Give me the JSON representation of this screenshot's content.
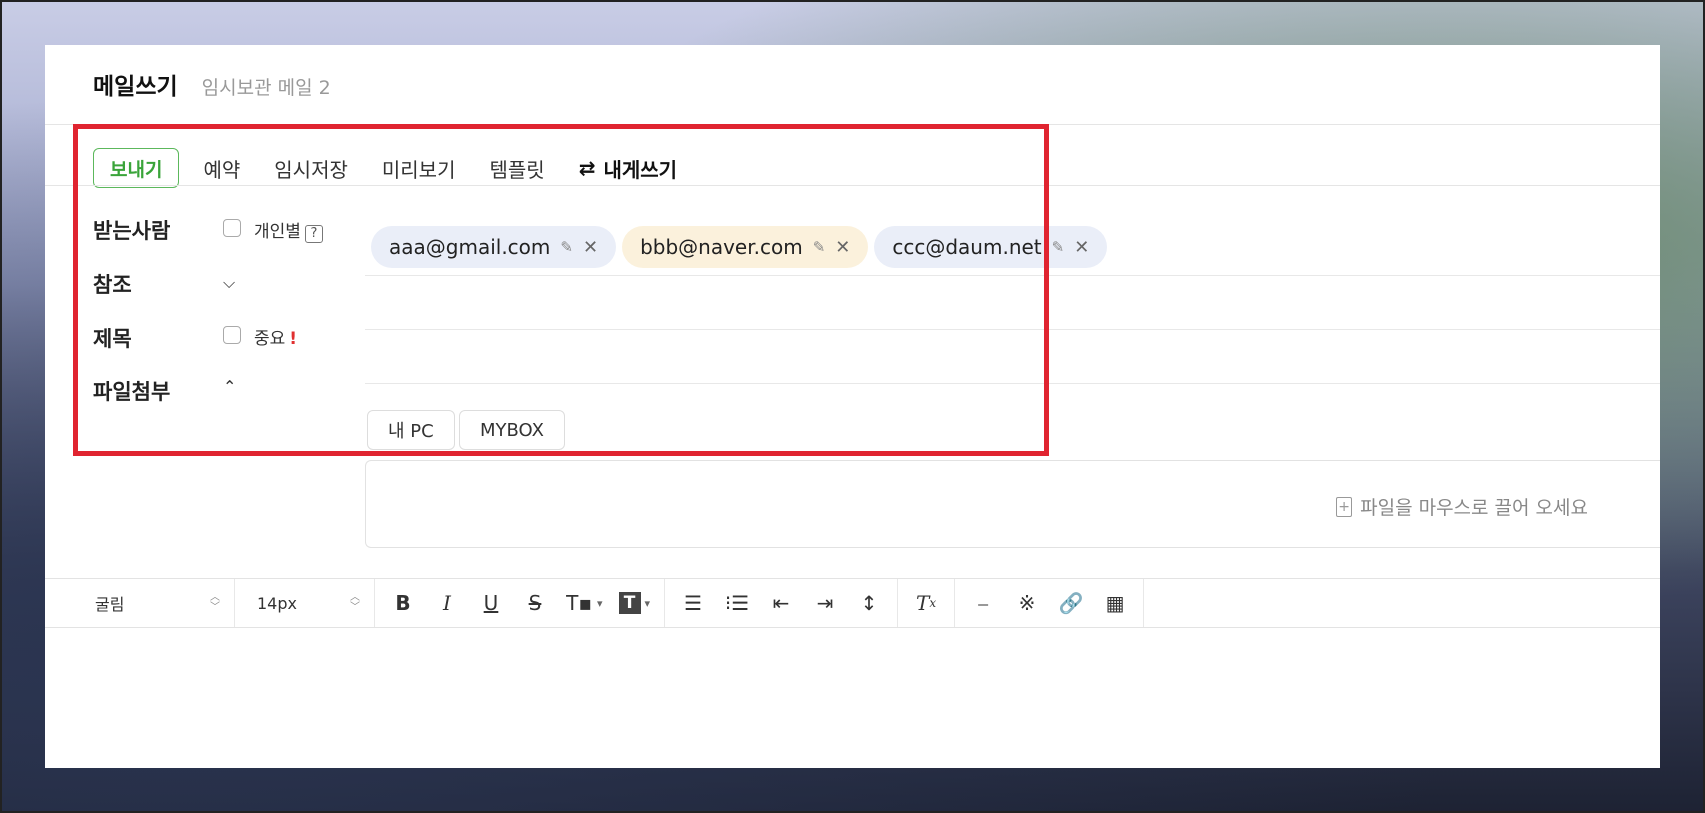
{
  "header": {
    "title": "메일쓰기",
    "subtitle": "임시보관 메일 2"
  },
  "toolbar": {
    "send": "보내기",
    "schedule": "예약",
    "save_draft": "임시저장",
    "preview": "미리보기",
    "template": "템플릿",
    "write_to_me": "내게쓰기",
    "swap_icon": "⇄"
  },
  "fields": {
    "recipients_label": "받는사람",
    "individual_label": "개인별",
    "help_mark": "?",
    "cc_label": "참조",
    "subject_label": "제목",
    "important_label": "중요",
    "important_mark": "!",
    "attach_label": "파일첨부"
  },
  "recipients": [
    {
      "email": "aaa@gmail.com"
    },
    {
      "email": "bbb@naver.com"
    },
    {
      "email": "ccc@daum.net"
    }
  ],
  "attach": {
    "my_pc": "내 PC",
    "mybox": "MYBOX",
    "drop_hint": "파일을 마우스로 끌어 오세요"
  },
  "editor": {
    "font": "굴림",
    "size": "14px"
  },
  "colors": {
    "accent": "#3aa43a",
    "highlight_box": "#e02430",
    "chip_default": "#eaeef8",
    "chip_warn": "#fbf1dc"
  }
}
